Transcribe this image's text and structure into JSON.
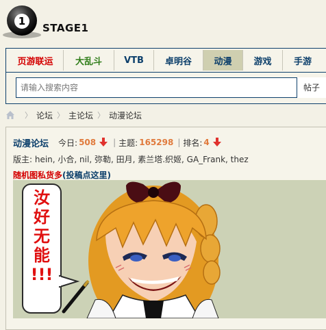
{
  "site": {
    "logo_number": "1",
    "name": "STAGE1"
  },
  "nav": {
    "items": [
      {
        "label": "页游联运",
        "color": "#d40000"
      },
      {
        "label": "大乱斗",
        "color": "#2f7d19"
      },
      {
        "label": "VTB",
        "color": "#0c3f6b"
      },
      {
        "label": "卓明谷",
        "color": "#0c3f6b"
      },
      {
        "label": "动漫",
        "color": "#0c3f6b",
        "active": true
      },
      {
        "label": "游戏",
        "color": "#0c3f6b"
      },
      {
        "label": "手游",
        "color": "#0c3f6b"
      }
    ]
  },
  "search": {
    "placeholder": "请输入搜索内容",
    "value": "",
    "type_label": "帖子"
  },
  "breadcrumb": {
    "items": [
      "论坛",
      "主论坛",
      "动漫论坛"
    ]
  },
  "forum": {
    "name": "动漫论坛",
    "today_label": "今日:",
    "today_value": "508",
    "topics_label": "主题:",
    "topics_value": "165298",
    "rank_label": "排名:",
    "rank_value": "4",
    "moderators_text": "版主: hein, 小合, nil, 弥勒, 田月, 素兰塔.织姬, GA_Frank, thez",
    "random_link_red": "随机图私货多",
    "random_link_blue": "(投稿点这里)"
  },
  "banner": {
    "speech_text": [
      "汝",
      "好",
      "无",
      "能",
      "!!!"
    ]
  },
  "colors": {
    "accent": "#0c3f6b",
    "stat_orange": "#e07a3c",
    "red": "#d40000",
    "active_tab_bg": "#cfcfb0"
  }
}
